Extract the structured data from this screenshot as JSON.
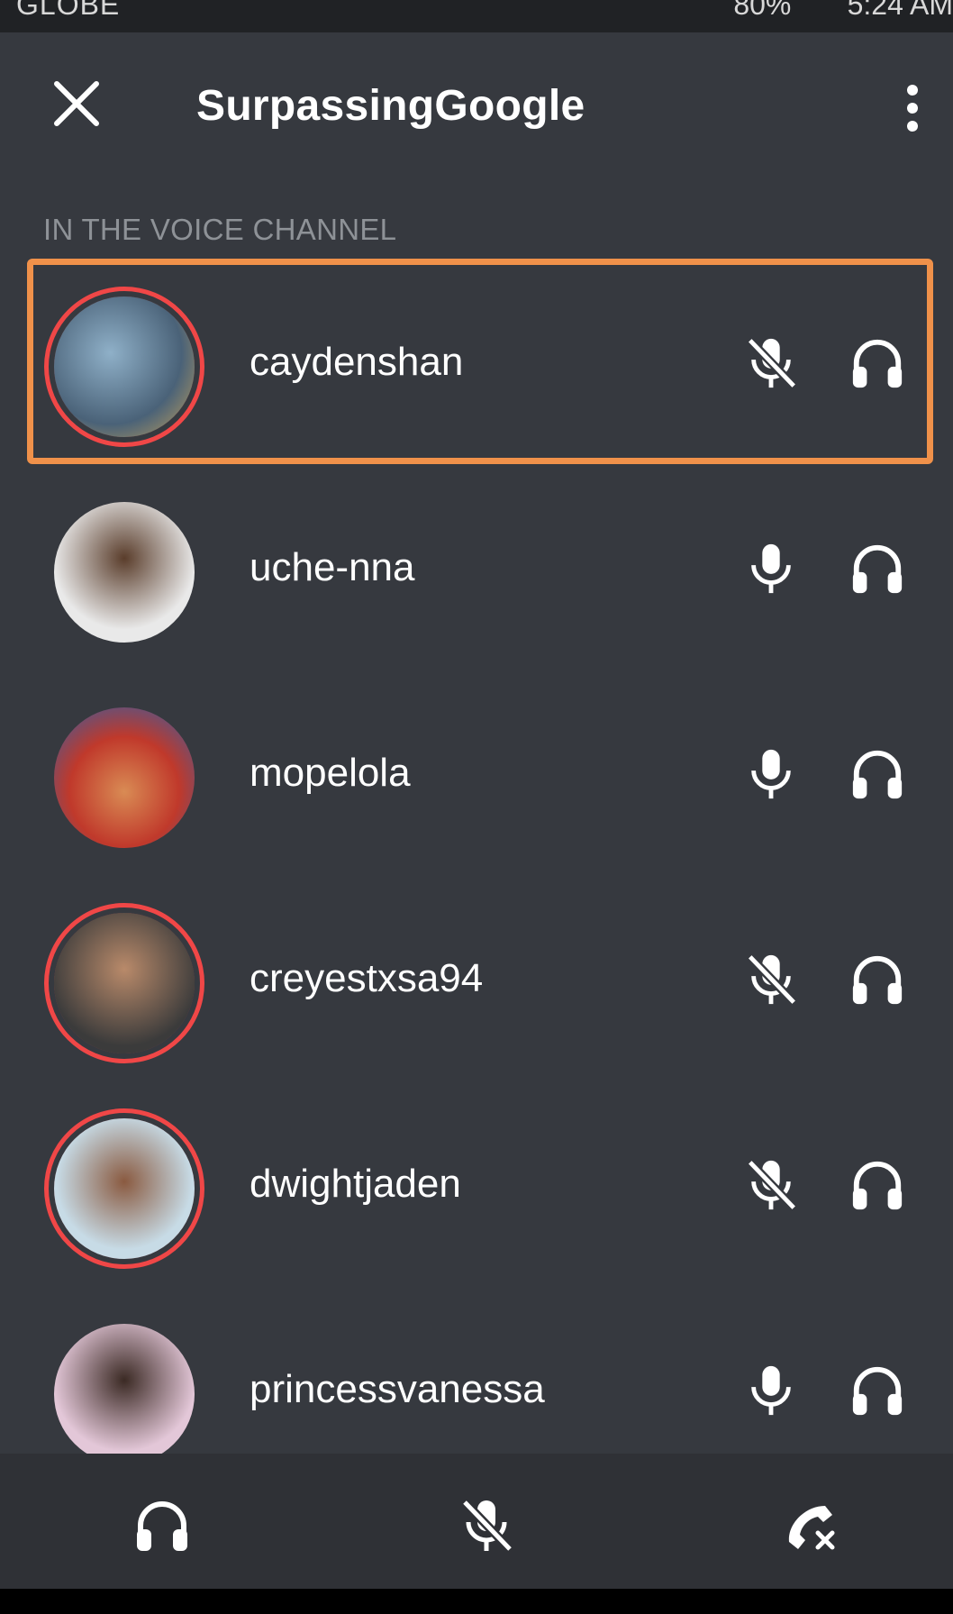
{
  "status_bar": {
    "carrier": "GLOBE",
    "battery_percent": "80%",
    "time": "5:24 AM"
  },
  "header": {
    "title": "SurpassingGoogle"
  },
  "section_label": "IN THE VOICE CHANNEL",
  "participants": [
    {
      "username": "caydenshan",
      "mic": "muted",
      "speaking": true,
      "highlighted": true
    },
    {
      "username": "uche-nna",
      "mic": "on",
      "speaking": false,
      "highlighted": false
    },
    {
      "username": "mopelola",
      "mic": "on",
      "speaking": false,
      "highlighted": false
    },
    {
      "username": "creyestxsa94",
      "mic": "muted",
      "speaking": true,
      "highlighted": false
    },
    {
      "username": "dwightjaden",
      "mic": "muted",
      "speaking": true,
      "highlighted": false
    },
    {
      "username": "princessvanessa",
      "mic": "on",
      "speaking": false,
      "highlighted": false
    }
  ],
  "colors": {
    "background": "#36393f",
    "bottom_bar": "#2f3136",
    "highlight": "#f0914a",
    "speaking_ring": "#f04747",
    "section_label": "#8e9297"
  },
  "bottom_bar": {
    "icons": [
      "headset-icon",
      "mic-muted-icon",
      "disconnect-call-icon"
    ]
  }
}
